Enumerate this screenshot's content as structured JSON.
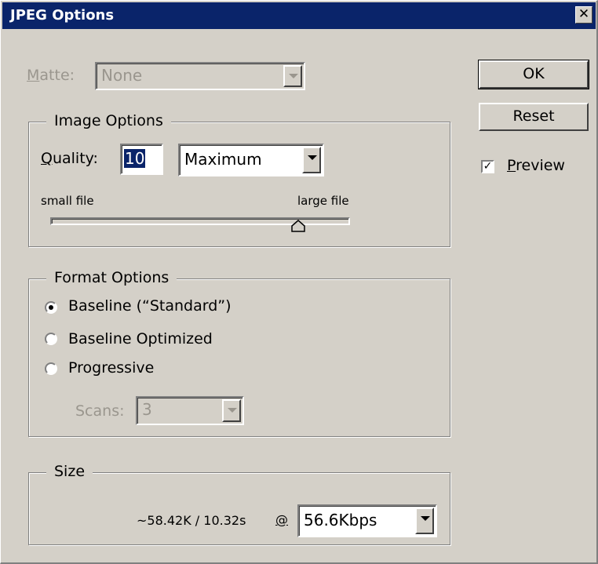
{
  "window": {
    "title": "JPEG Options"
  },
  "matte": {
    "label_first": "M",
    "label_rest": "atte:",
    "value": "None"
  },
  "buttons": {
    "ok": "OK",
    "reset": "Reset"
  },
  "preview": {
    "label_first": "P",
    "label_rest": "review",
    "checked": true
  },
  "image_options": {
    "legend": "Image Options",
    "quality_label_first": "Q",
    "quality_label_rest": "uality:",
    "quality_value": "10",
    "quality_preset": "Maximum",
    "slider_min_label": "small file",
    "slider_max_label": "large file",
    "slider_level": 10,
    "slider_max": 12
  },
  "format_options": {
    "legend": "Format Options",
    "options": [
      "Baseline (“Standard”)",
      "Baseline Optimized",
      "Progressive"
    ],
    "selected_index": 0,
    "scans_label": "Scans:",
    "scans_value": "3"
  },
  "size": {
    "legend": "Size",
    "estimate": "~58.42K / 10.32s",
    "at_symbol": "@",
    "speed": "56.6Kbps"
  }
}
